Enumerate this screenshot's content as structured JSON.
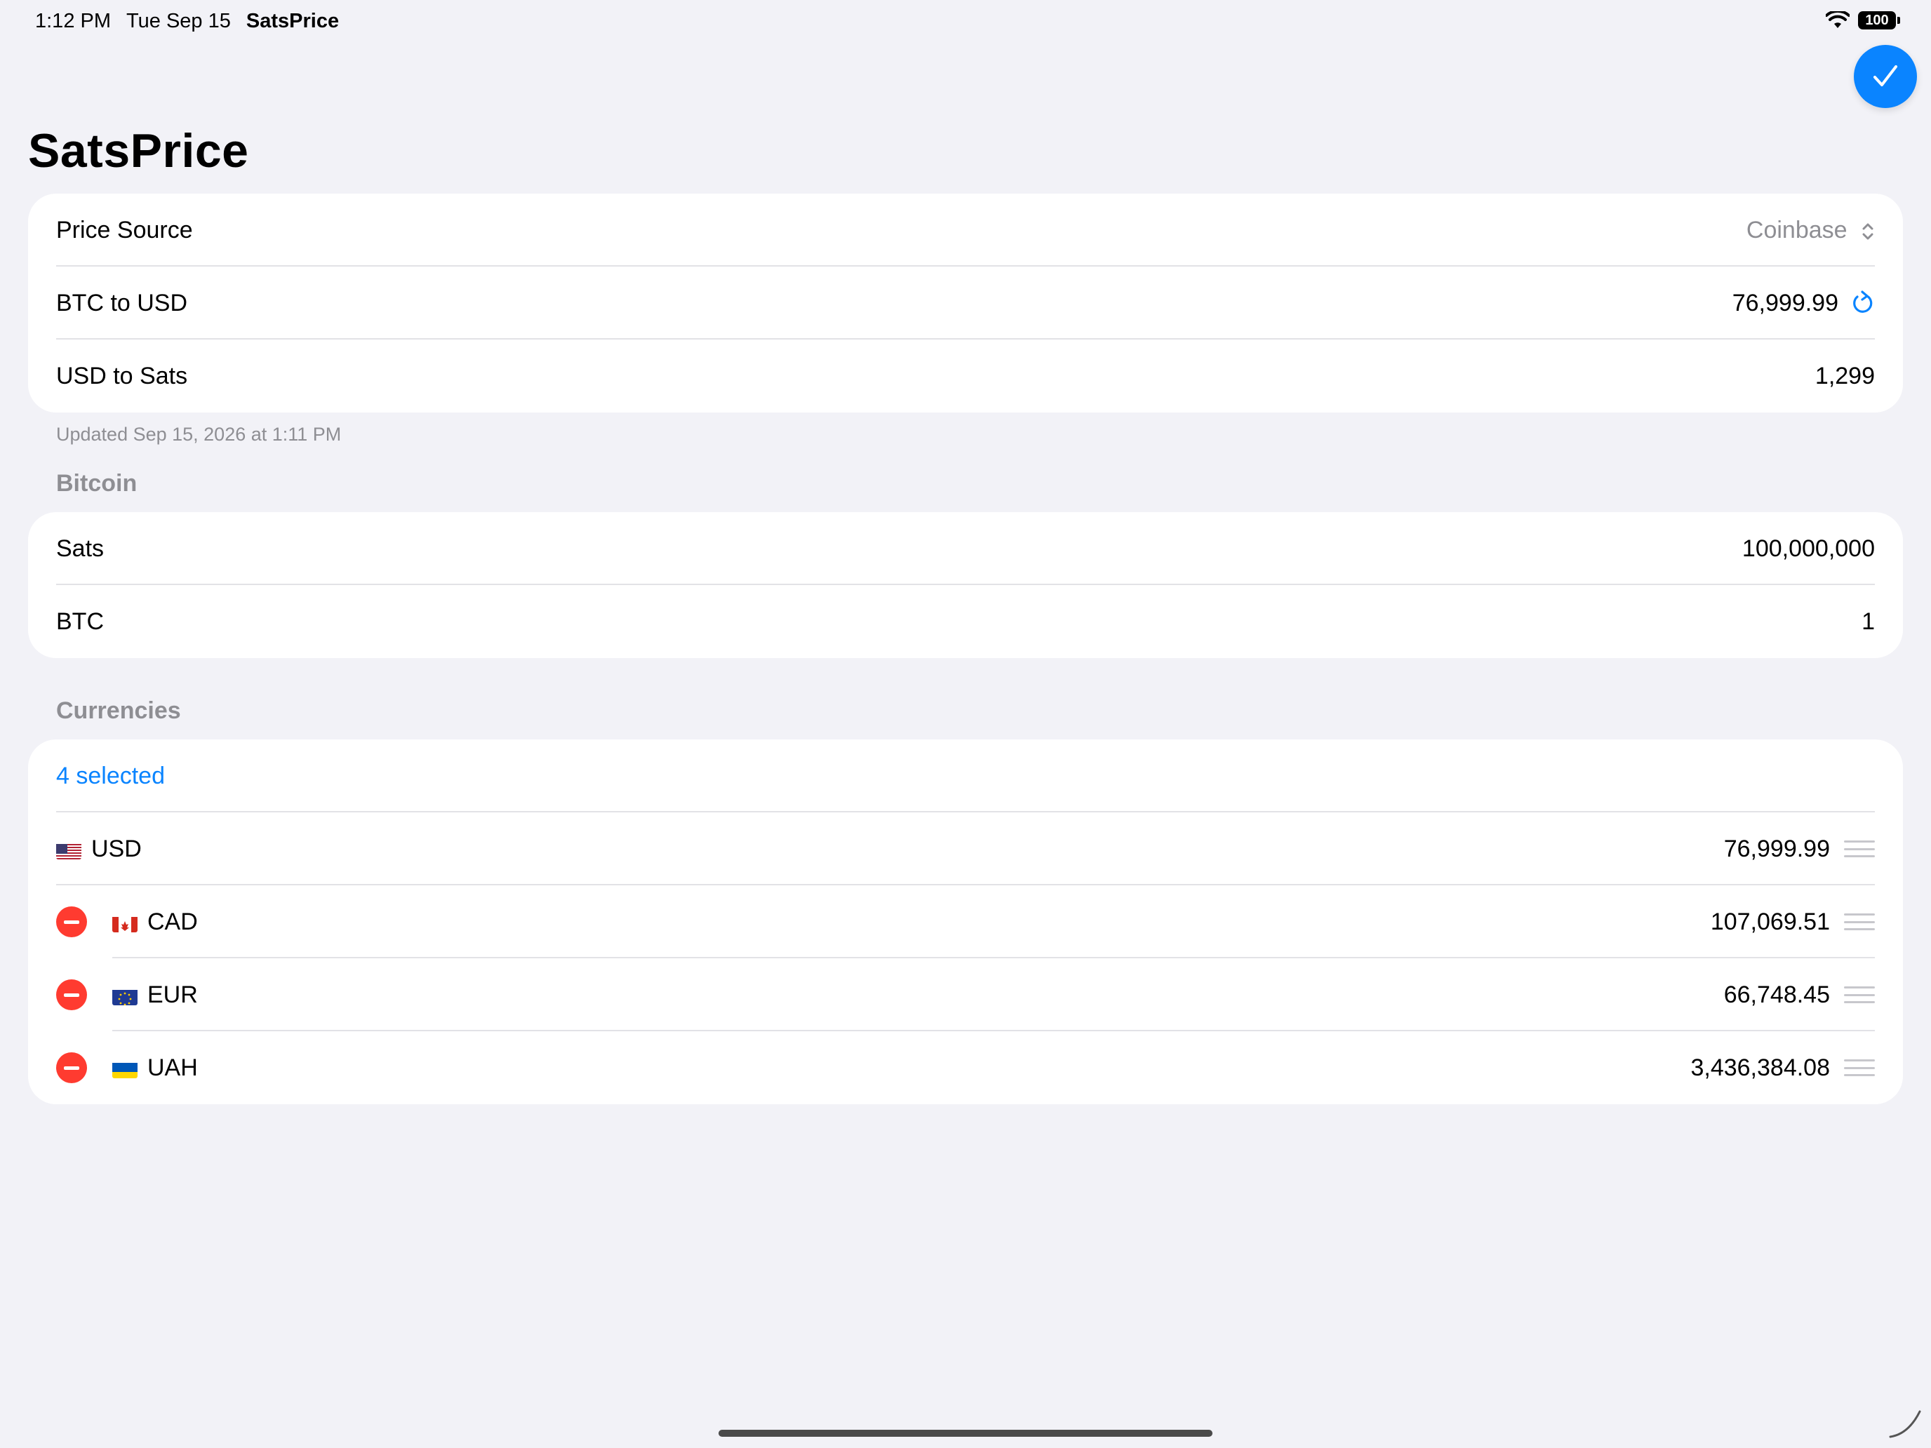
{
  "status_bar": {
    "time": "1:12 PM",
    "date": "Tue Sep 15",
    "app": "SatsPrice",
    "battery": "100"
  },
  "toolbar": {
    "done_icon": "checkmark-icon"
  },
  "page": {
    "title": "SatsPrice"
  },
  "price_section": {
    "rows": [
      {
        "label": "Price Source",
        "value": "Coinbase"
      },
      {
        "label": "BTC to USD",
        "value": "76,999.99"
      },
      {
        "label": "USD to Sats",
        "value": "1,299"
      }
    ],
    "footnote": "Updated Sep 15, 2026 at 1:11 PM"
  },
  "bitcoin_section": {
    "header": "Bitcoin",
    "rows": [
      {
        "label": "Sats",
        "value": "100,000,000"
      },
      {
        "label": "BTC",
        "value": "1"
      }
    ]
  },
  "currencies_section": {
    "header": "Currencies",
    "selected_label": "4 selected",
    "rows": [
      {
        "code": "USD",
        "value": "76,999.99",
        "flag": "us-flag"
      },
      {
        "code": "CAD",
        "value": "107,069.51",
        "flag": "ca-flag"
      },
      {
        "code": "EUR",
        "value": "66,748.45",
        "flag": "eu-flag"
      },
      {
        "code": "UAH",
        "value": "3,436,384.08",
        "flag": "ua-flag"
      }
    ]
  },
  "colors": {
    "accent": "#0a84ff",
    "delete": "#ff3b30",
    "background": "#f2f2f7"
  }
}
